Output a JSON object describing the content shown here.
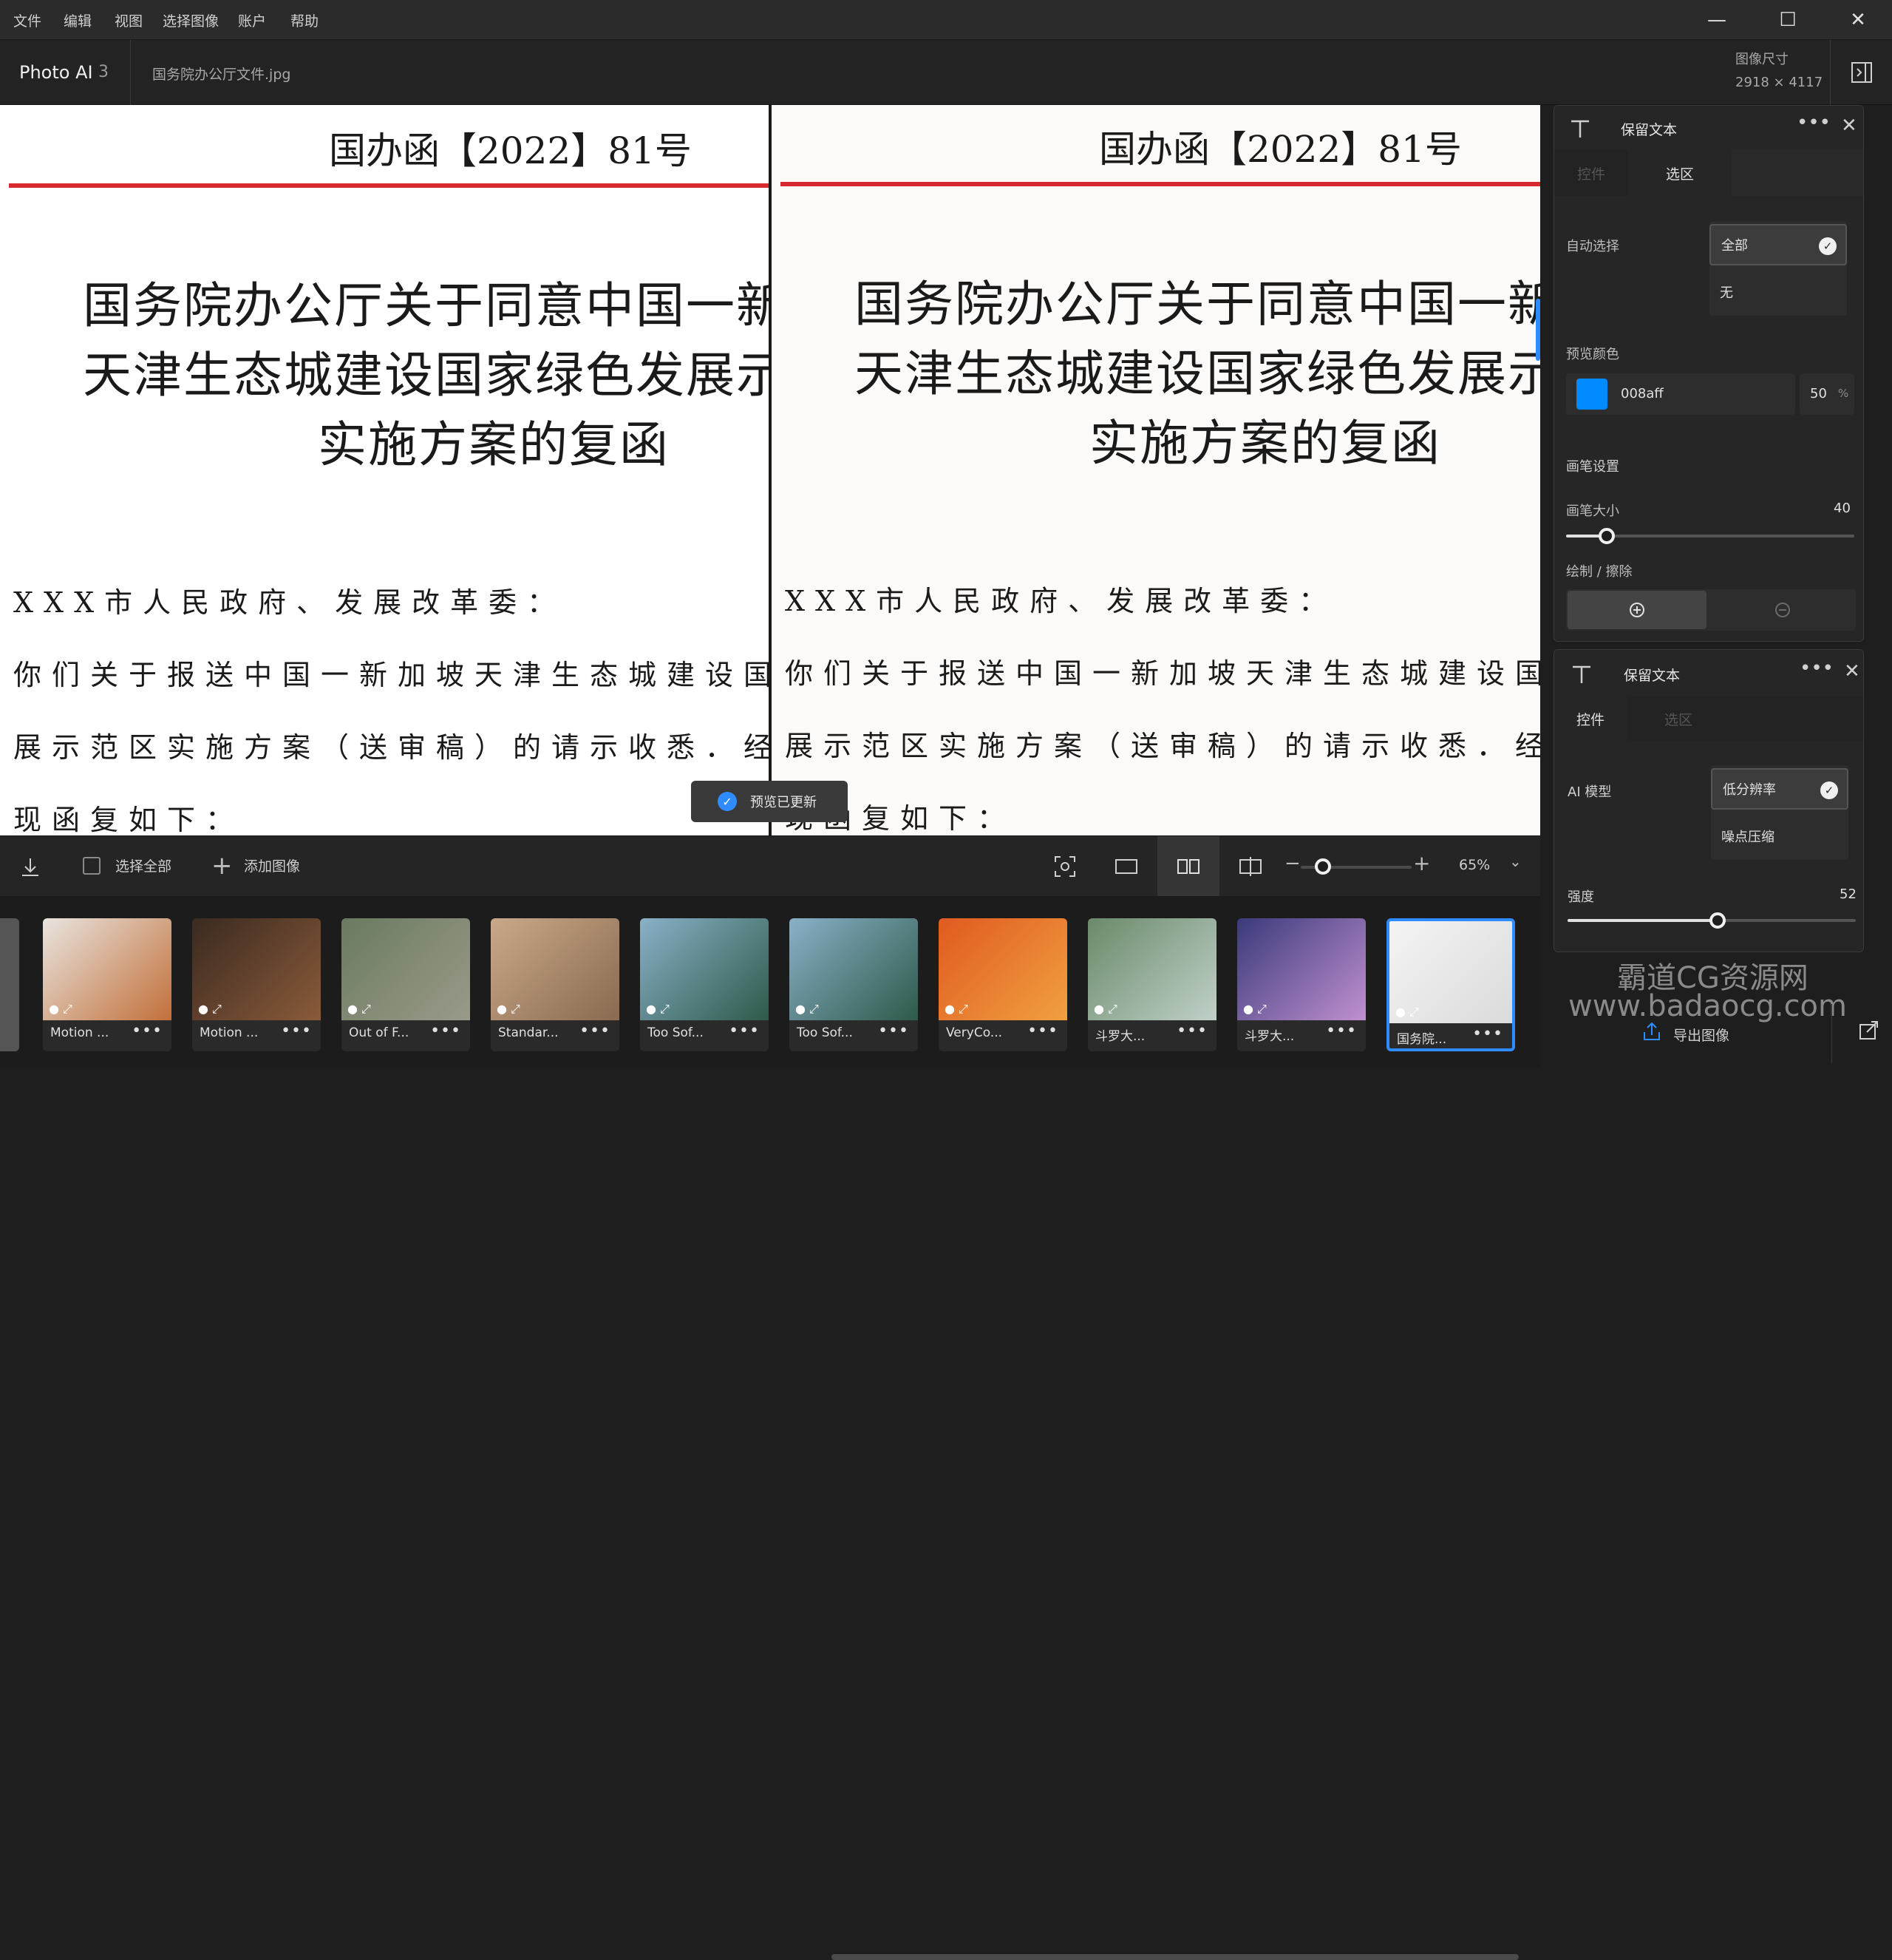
{
  "menubar": {
    "items": [
      "文件",
      "编辑",
      "视图",
      "选择图像",
      "账户",
      "帮助"
    ],
    "minimize": "—",
    "maximize": "☐",
    "close": "✕"
  },
  "header": {
    "app_name": "Photo AI",
    "app_version": "3",
    "file_name": "国务院办公厅文件.jpg",
    "size_label": "图像尺寸",
    "size_value": "2918 × 4117"
  },
  "document": {
    "number": "国办函【2022】81号",
    "title_lines": [
      "国务院办公厅关于同意中国一新加坡",
      "天津生态城建设国家绿色发展示范区",
      "实施方案的复函"
    ],
    "body_lines": [
      "XXX市人民政府、发展改革委：",
      "你们关于报送中国一新加坡天津生态城建设国家绿色发",
      "展示范区实施方案（送审稿）的请示收悉．经国务院同意，",
      "现函复如下："
    ]
  },
  "toast": {
    "text": "预览已更新"
  },
  "toolbar": {
    "select_all": "选择全部",
    "add_image": "添加图像",
    "zoom": "65%",
    "zoom_level": 0.2
  },
  "thumbnails": [
    {
      "label": "Motion ...",
      "color1": "#e8e4df",
      "color2": "#c2703a"
    },
    {
      "label": "Motion ...",
      "color1": "#3a2a20",
      "color2": "#8a5a3a"
    },
    {
      "label": "Out of F...",
      "color1": "#6a7a60",
      "color2": "#9a9a8a"
    },
    {
      "label": "Standar...",
      "color1": "#c9a88a",
      "color2": "#8a6a50"
    },
    {
      "label": "Too Sof...",
      "color1": "#8ab0c8",
      "color2": "#2e5a4a"
    },
    {
      "label": "Too Sof...",
      "color1": "#8ab0c8",
      "color2": "#2e5a4a"
    },
    {
      "label": "VeryCo...",
      "color1": "#e05a20",
      "color2": "#f0a040"
    },
    {
      "label": "斗罗大...",
      "color1": "#6a8a6a",
      "color2": "#c0d0c8"
    },
    {
      "label": "斗罗大...",
      "color1": "#3a3a7a",
      "color2": "#c090d0"
    },
    {
      "label": "国务院...",
      "color1": "#f4f4f4",
      "color2": "#dadada"
    }
  ],
  "panel1": {
    "title": "保留文本",
    "tab_controls": "控件",
    "tab_selection": "选区",
    "auto_select_label": "自动选择",
    "auto_select_options": [
      "全部",
      "无"
    ],
    "preview_color_label": "预览颜色",
    "preview_color_hex": "008aff",
    "preview_color_value": "#008aff",
    "opacity": "50",
    "opacity_unit": "%",
    "brush_settings": "画笔设置",
    "brush_size_label": "画笔大小",
    "brush_size": "40",
    "brush_size_fraction": 0.14,
    "draw_erase_label": "绘制 / 擦除"
  },
  "panel2": {
    "title": "保留文本",
    "tab_controls": "控件",
    "tab_selection": "选区",
    "ai_model_label": "AI 模型",
    "ai_model_options": [
      "低分辨率",
      "噪点压缩"
    ],
    "strength_label": "强度",
    "strength": "52",
    "strength_fraction": 0.52
  },
  "footer": {
    "export": "导出图像"
  },
  "watermark": {
    "line1": "霸道CG资源网",
    "line2": "www.badaocg.com"
  }
}
